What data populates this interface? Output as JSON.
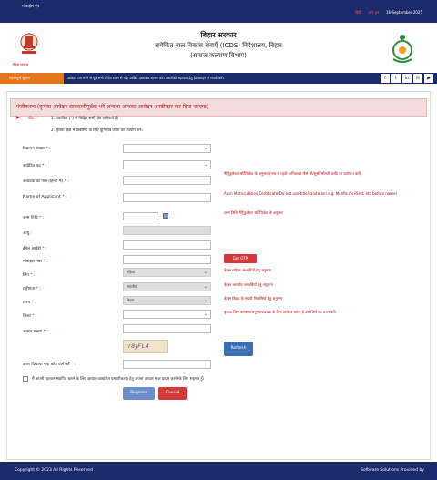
{
  "topbar": {
    "left_text": "मोबाईल ऐप",
    "lang_text": "हिंदी",
    "login_text": "लॉग इन",
    "date": "16-September-2025"
  },
  "header": {
    "emblem_label": "बिहार सरकार",
    "title_1": "बिहार सरकार",
    "title_2": "समेकित बाल विकास सेवाएँ (ICDS) निदेशालय, बिहार",
    "title_3": "(समाज कल्याण विभाग)"
  },
  "nav": {
    "important_label": "महत्वपूर्ण सूचना",
    "ticker": "आवेदन पत्र भरने से पूर्व सभी निर्देश ध्यान से पढ़ें। वांछित दस्तावेज संलग्न करें। तकनीकी सहायता हेतु हेल्पलाइन से संपर्क करें।",
    "social": [
      "f",
      "t",
      "in",
      "✉",
      "▶"
    ]
  },
  "panel": {
    "heading": "पंजीकरण (कृपया आवेदन सावधानीपूर्वक भरें अन्यथा आपका आवेदन अस्वीकार कर दिया जाएगा)"
  },
  "notes": {
    "title": "नोट :-",
    "line1": "1. तारांकित (*) से चिह्नित सभी क्षेत्र अनिवार्य हैं।",
    "line2": "2. कृपया हिंदी में प्रविष्टियों के लिए यूनिकोड फ़ॉन्ट का उपयोग करें।"
  },
  "form": {
    "fields": [
      {
        "label": "विज्ञापन संख्या",
        "required": true
      },
      {
        "label": "आवेदित पद",
        "required": true
      },
      {
        "label": "आवेदक का नाम (हिन्दी में)",
        "required": true
      },
      {
        "label": "Name of Applicant",
        "required": true
      },
      {
        "label": "जन्म तिथि",
        "required": true
      },
      {
        "label": "आयु",
        "required": false
      },
      {
        "label": "ईमेल आईडी",
        "required": true
      },
      {
        "label": "मोबाइल नंबर",
        "required": true
      },
      {
        "label": "लिंग",
        "required": true
      },
      {
        "label": "राष्ट्रीयता",
        "required": true
      },
      {
        "label": "राज्य",
        "required": true
      },
      {
        "label": "जिला",
        "required": true
      },
      {
        "label": "आधार संख्या",
        "required": true
      },
      {
        "label": "ऊपर दिखाया गया कोड दर्ज करें",
        "required": true
      }
    ],
    "gender_value": "महिला",
    "nationality_value": "भारतीय",
    "state_value": "बिहार"
  },
  "hints": {
    "name_hi": "मैट्रिकुलेशन सर्टिफिकेट के अनुसार (नाम से पहले अभिवादन जैसे श्री/सुश्री/श्रीमती आदि का प्रयोग न करें)",
    "name_en": "As in Matriculation Certificate(Do not use title/salutation e.g. Mr./Ms./Sri/Smt. etc before name)",
    "dob": "जन्म तिथि मैट्रिकुलेशन सर्टिफिकेट के अनुसार",
    "gender": "केवल महिला अभ्यर्थियाँ हेतु अनुमन्य",
    "nationality": "केवल भारतीय अभ्यर्थियाँ हेतु अनुमन्य",
    "state": "केवल बिहार के स्थायी निवासियों हेतु अनुमन्य",
    "district": "कृपया जिस कलस्टर/अनुमंडल/प्रखंड के लिए आवेदन करना है उस जिले का चयन करें।"
  },
  "buttons": {
    "otp": "Get OTP",
    "refresh": "Refresh",
    "register": "Register",
    "cancel": "Cancel"
  },
  "captcha": {
    "code": "r8JFL4"
  },
  "consent": {
    "text": "मैं अपनी पहचान स्थापित करने के लिए आधार-आधारित प्रमाणीकरण हेतु अपना आधार नंबर प्रदान करने के लिए सहमत हूँ।"
  },
  "footer": {
    "copyright": "Copyright © 2023 All Rights Reserved",
    "solutions": "Software Solutions Provided by"
  },
  "colors": {
    "navy": "#1a2a6b",
    "accent_orange": "#e6761e",
    "danger": "#d43838",
    "primary": "#3a6fb0"
  }
}
